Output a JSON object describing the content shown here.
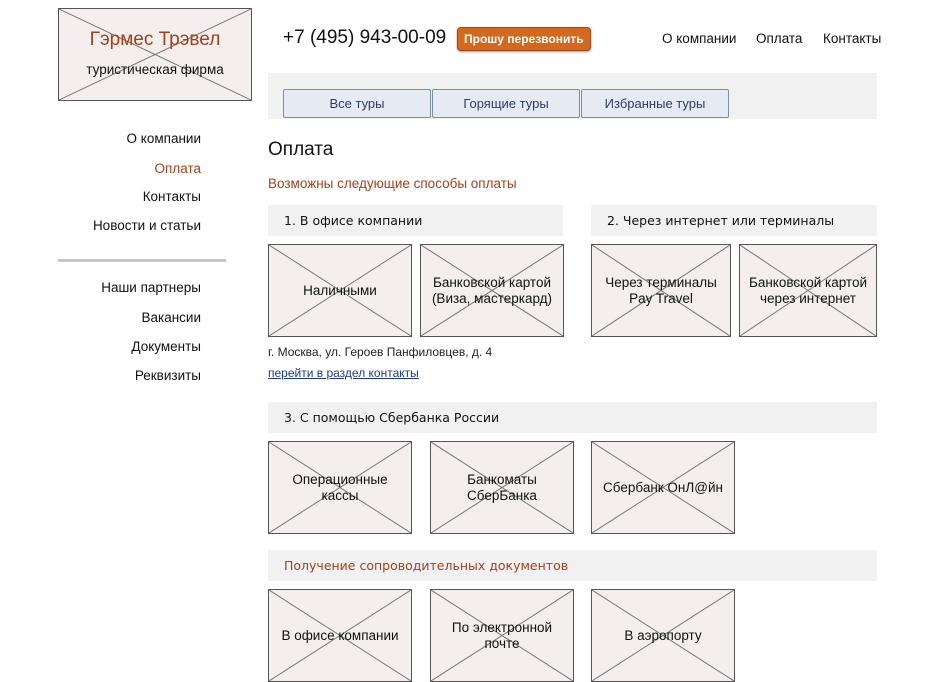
{
  "logo": {
    "title": "Гэрмес Трэвел",
    "subtitle": "туристическая фирма"
  },
  "header": {
    "phone": "+7 (495) 943-00-09",
    "callback_label": "Прошу перезвонить",
    "nav": [
      "О компании",
      "Оплата",
      "Контакты"
    ]
  },
  "sidebar": {
    "group1": [
      "О компании",
      "Оплата",
      "Контакты",
      "Новости и статьи"
    ],
    "active": "Оплата",
    "group2": [
      "Наши партнеры",
      "Вакансии",
      "Документы",
      "Реквизиты"
    ]
  },
  "tabs": [
    "Все туры",
    "Горящие туры",
    "Избранные туры"
  ],
  "page": {
    "title": "Оплата",
    "intro": "Возможны следующие способы оплаты",
    "section1": {
      "heading": "1. В офисе компании",
      "cards": [
        "Наличными",
        "Банковской картой\n(Виза, мастеркард)"
      ],
      "address": "г. Москва, ул. Героев Панфиловцев, д. 4",
      "link": "перейти в раздел контакты"
    },
    "section2": {
      "heading": "2. Через интернет или терминалы",
      "cards": [
        "Через терминалы\nPay Travel",
        "Банковской картой\nчерез интернет"
      ]
    },
    "section3": {
      "heading": "3. С помощью Сбербанка России",
      "cards": [
        "Операционные кассы",
        "Банкоматы СберБанка",
        "Сбербанк ОнЛ@йн"
      ]
    },
    "section4": {
      "heading": "Получение сопроводительных документов",
      "cards": [
        "В офисе компании",
        "По электронной почте",
        "В аэропорту"
      ]
    }
  },
  "colors": {
    "accent": "#a4401a",
    "button": "#d2691e",
    "bar": "#f1f1f1",
    "placeholder": "#f5eeee"
  }
}
